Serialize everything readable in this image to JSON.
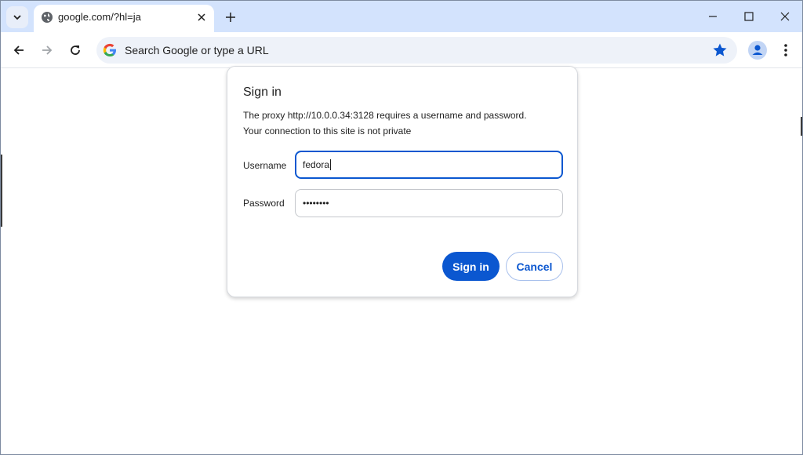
{
  "browser": {
    "tab": {
      "title": "google.com/?hl=ja"
    },
    "omnibox": {
      "placeholder": "Search Google or type a URL"
    }
  },
  "dialog": {
    "title": "Sign in",
    "message_line1": "The proxy http://10.0.0.34:3128 requires a username and password.",
    "message_line2": "Your connection to this site is not private",
    "username_label": "Username",
    "username_value": "fedora",
    "password_label": "Password",
    "password_value": "••••••••",
    "sign_in_label": "Sign in",
    "cancel_label": "Cancel"
  },
  "colors": {
    "titlebar": "#d3e3fd",
    "accent": "#0b57d0",
    "omnibox_bg": "#eef2f9"
  },
  "icons": [
    "chevron-down-icon",
    "globe-icon",
    "close-icon",
    "plus-icon",
    "minimize-icon",
    "maximize-icon",
    "back-arrow-icon",
    "forward-arrow-icon",
    "reload-icon",
    "google-g-icon",
    "star-icon",
    "profile-icon",
    "kebab-menu-icon"
  ]
}
